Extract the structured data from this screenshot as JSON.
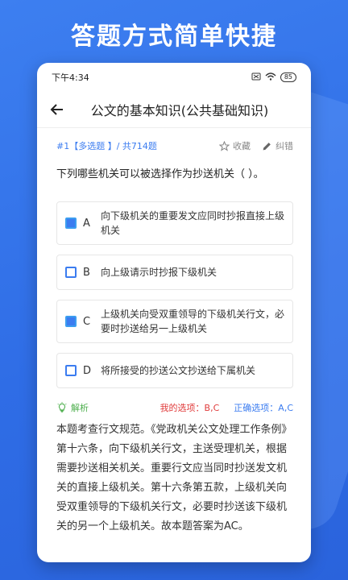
{
  "headline": "答题方式简单快捷",
  "status": {
    "time": "下午4:34",
    "battery": "85"
  },
  "nav": {
    "title": "公文的基本知识(公共基础知识)"
  },
  "meta": {
    "info": "#1【多选题 】/ 共714题",
    "favorite": "收藏",
    "report": "纠错"
  },
  "question": "下列哪些机关可以被选择作为抄送机关（   ）。",
  "options": [
    {
      "letter": "A",
      "text": "向下级机关的重要发文应同时抄报直接上级机关",
      "checked": true
    },
    {
      "letter": "B",
      "text": "向上级请示时抄报下级机关",
      "checked": false
    },
    {
      "letter": "C",
      "text": "上级机关向受双重领导的下级机关行文，必要时抄送给另一上级机关",
      "checked": true
    },
    {
      "letter": "D",
      "text": "将所接受的抄送公文抄送给下属机关",
      "checked": false
    }
  ],
  "analysis": {
    "label": "解析",
    "my_answer": "我的选项：B,C",
    "correct_answer": "正确选项：A,C"
  },
  "explanation": "本题考查行文规范。《党政机关公文处理工作条例》第十六条，向下级机关行文，主送受理机关，根据需要抄送相关机关。重要行文应当同时抄送发文机关的直接上级机关。第十六条第五款，上级机关向受双重领导的下级机关行文，必要时抄送该下级机关的另一个上级机关。故本题答案为AC。"
}
